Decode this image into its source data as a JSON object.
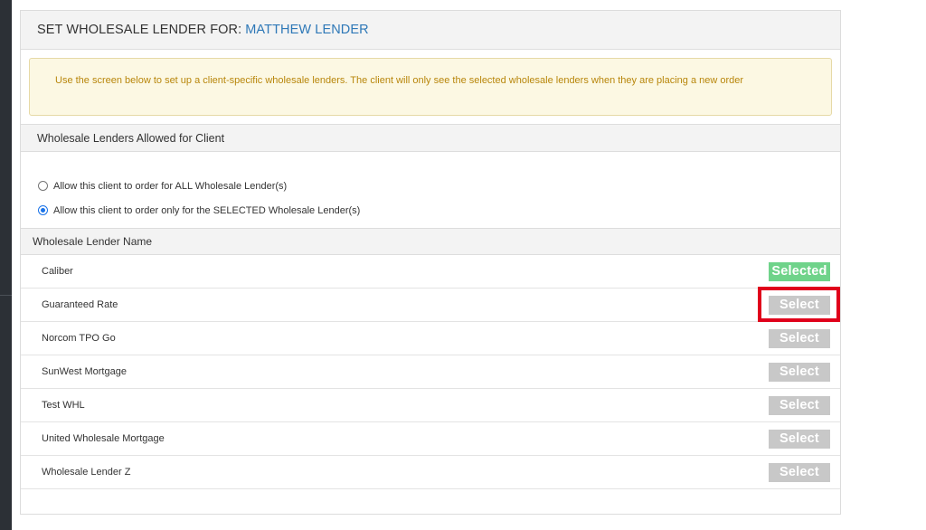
{
  "header": {
    "title_prefix": "SET WHOLESALE LENDER FOR:",
    "client_name": "MATTHEW LENDER"
  },
  "notice": {
    "text": "Use the screen below to set up a client-specific wholesale lenders. The client will only see the selected wholesale lenders when they are placing a new order"
  },
  "section": {
    "title": "Wholesale Lenders Allowed for Client"
  },
  "options": [
    {
      "label": "Allow this client to order for ALL Wholesale Lender(s)",
      "checked": false
    },
    {
      "label": "Allow this client to order only for the SELECTED Wholesale Lender(s)",
      "checked": true
    }
  ],
  "table": {
    "column_header": "Wholesale Lender Name",
    "rows": [
      {
        "name": "Caliber",
        "button": "Selected",
        "state": "selected"
      },
      {
        "name": "Guaranteed Rate",
        "button": "Select",
        "state": "unselected",
        "highlighted": true
      },
      {
        "name": "Norcom TPO Go",
        "button": "Select",
        "state": "unselected"
      },
      {
        "name": "SunWest Mortgage",
        "button": "Select",
        "state": "unselected"
      },
      {
        "name": "Test WHL",
        "button": "Select",
        "state": "unselected"
      },
      {
        "name": "United Wholesale Mortgage",
        "button": "Select",
        "state": "unselected"
      },
      {
        "name": "Wholesale Lender Z",
        "button": "Select",
        "state": "unselected"
      }
    ]
  },
  "colors": {
    "client_name": "#2e78b7",
    "selected_button": "#6fd38a",
    "select_button": "#c8c8c8",
    "highlight_border": "#e0001b",
    "notice_text": "#b8860b"
  }
}
